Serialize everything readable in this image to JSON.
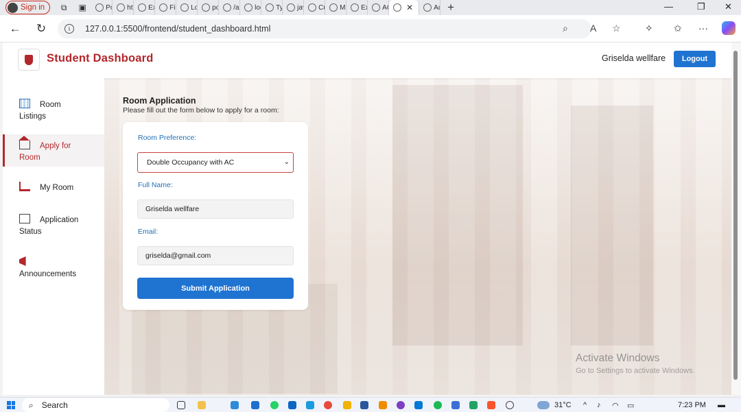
{
  "browser": {
    "signin_label": "Sign in",
    "tabs": [
      "Poo",
      "http",
      "Exa",
      "Fire",
      "Log",
      "post",
      "/api",
      "loca",
      "Typ",
      "java",
      "Cur",
      "MO",
      "Exa",
      "ACI",
      "",
      "Adn"
    ],
    "url": "127.0.0.1:5500/frontend/student_dashboard.html"
  },
  "header": {
    "brand": "Student Dashboard",
    "username": "Griselda wellfare",
    "logout_label": "Logout"
  },
  "sidebar": {
    "items": [
      {
        "label1": "Room",
        "label2": "Listings",
        "icon": "grid-icon"
      },
      {
        "label1": "Apply for",
        "label2": "Room",
        "icon": "home-icon"
      },
      {
        "label1": "My Room",
        "label2": "",
        "icon": "bed-icon"
      },
      {
        "label1": "Application",
        "label2": "Status",
        "icon": "document-icon"
      },
      {
        "label1": "Announcements",
        "label2": "",
        "icon": "megaphone-icon"
      }
    ]
  },
  "form": {
    "title": "Room Application",
    "subtitle": "Please fill out the form below to apply for a room:",
    "room_pref_label": "Room Preference:",
    "room_pref_value": "Double Occupancy with AC",
    "name_label": "Full Name:",
    "name_value": "Griselda wellfare",
    "email_label": "Email:",
    "email_value": "griselda@gmail.com",
    "submit_label": "Submit Application"
  },
  "watermark": {
    "line1": "Activate Windows",
    "line2": "Go to Settings to activate Windows."
  },
  "taskbar": {
    "search_label": "Search",
    "weather": "31°C",
    "time": "7:23 PM"
  },
  "colors": {
    "brand_red": "#b3262b",
    "primary_blue": "#1f73d1",
    "label_blue": "#1f6fb8"
  }
}
